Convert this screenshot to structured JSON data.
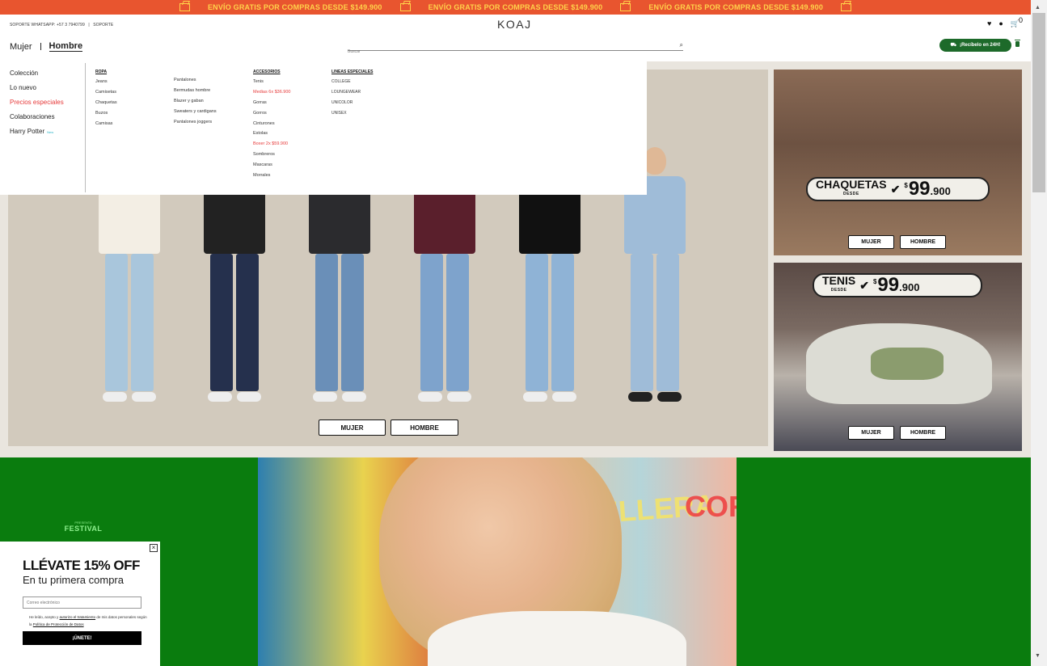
{
  "promo": {
    "text": "ENVÍO GRATIS POR COMPRAS DESDE $149.900",
    "icon": "box-icon",
    "color": "#e8552f"
  },
  "header": {
    "support_whatsapp": "SOPORTE WHATSAPP: +57 3 7940799",
    "support_sep": "|",
    "support_link": "SOPORTE",
    "logo": "KOAJ",
    "icons": [
      "heart-icon",
      "user-icon",
      "cart-icon"
    ],
    "cart_count": "0"
  },
  "gender": {
    "women": "Mujer",
    "men": "Hombre"
  },
  "search": {
    "placeholder": "Buscar"
  },
  "delivery": {
    "label": "¡Recíbelo en 24H!",
    "color": "#1d6a2a"
  },
  "mega_menu": {
    "left": [
      "Colección",
      "Lo nuevo",
      "Precios especiales",
      "Colaboraciones",
      "Harry Potter"
    ],
    "new_badge": "New",
    "ropa": {
      "heading": "ROPA",
      "col1": [
        "Jeans",
        "Camisetas",
        "Chaquetas",
        "Buzos",
        "Camisas"
      ],
      "col2": [
        "Pantalones",
        "Bermudas hombre",
        "Blazer y gaban",
        "Sweaters y cardigans",
        "Pantalones joggers"
      ]
    },
    "accesorios": {
      "heading": "ACCESORIOS",
      "items": [
        "Tenis",
        "Medias 6x $36.900",
        "Gorras",
        "Gorros",
        "Cinturones",
        "Estolas",
        "Boxer 2x $59.900",
        "Sombreros",
        "Mascaras",
        "Morrales"
      ]
    },
    "lineas": {
      "heading": "LINEAS ESPECIALES",
      "items": [
        "COLLEGE",
        "LOUNGEWEAR",
        "UNICOLOR",
        "UNISEX"
      ]
    }
  },
  "hero": {
    "btn_women": "MUJER",
    "btn_men": "HOMBRE"
  },
  "cards": {
    "jackets": {
      "label": "CHAQUETAS",
      "desde": "DESDE",
      "currency": "$",
      "price": "99",
      "price_cents": ".900",
      "btn_women": "MUJER",
      "btn_men": "HOMBRE"
    },
    "sneakers": {
      "label": "TENIS",
      "desde": "DESDE",
      "currency": "$",
      "price": "99",
      "price_cents": ".900",
      "btn_women": "MUJER",
      "btn_men": "HOMBRE"
    }
  },
  "festival": {
    "small": "PRESENTA",
    "big": "FESTIVAL",
    "posters": [
      "CORDILLERA",
      "COR"
    ]
  },
  "popup": {
    "title": "LLÉVATE 15% OFF",
    "subtitle": "En tu primera compra",
    "email_placeholder": "Correo electrónico",
    "legal_prefix": "He leído, acepto y",
    "legal_auth": "autorizo el tratamiento",
    "legal_mid": "de mis datos personales según la",
    "legal_policy": "Política de Protección de Datos",
    "cta": "¡ÚNETE!",
    "close": "×"
  }
}
